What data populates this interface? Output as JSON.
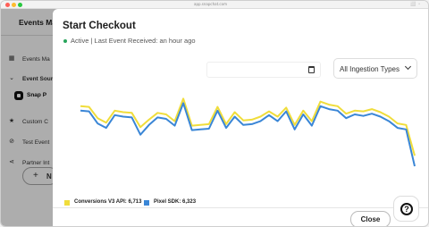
{
  "window": {
    "url": "app.snapchat.com"
  },
  "app": {
    "title": "Events Ma",
    "sidebar": {
      "items": [
        {
          "label": "Events Ma",
          "icon": "grid-icon"
        },
        {
          "label": "Event Sour",
          "icon": "chevron-down-icon"
        },
        {
          "label": "Snap P",
          "icon": "snap-pixel-icon"
        },
        {
          "label": "Custom C",
          "icon": "star-icon"
        },
        {
          "label": "Test Event",
          "icon": "check-circle-icon"
        },
        {
          "label": "Partner Int",
          "icon": "share-icon"
        }
      ],
      "new_button": {
        "plus": "+",
        "label": "N"
      }
    }
  },
  "modal": {
    "title": "Start Checkout",
    "status": "Active | Last Event Received: an hour ago",
    "status_color": "#27a55b",
    "date_range": "",
    "ingestion_select": {
      "selected": "All Ingestion Types"
    },
    "legend": [
      {
        "label": "Conversions V3 API: 6,713",
        "color": "#f0dd3b"
      },
      {
        "label": "Pixel SDK: 6,323",
        "color": "#3a86d6"
      }
    ],
    "close_label": "Close",
    "help_symbol": "?"
  },
  "chart_data": {
    "type": "line",
    "ylim": [
      0,
      100
    ],
    "grid": false,
    "legend_position": "bottom-left",
    "series": [
      {
        "name": "Conversions V3 API: 6,713",
        "color": "#f0dd3b",
        "values": [
          86,
          85,
          70,
          64,
          80,
          78,
          77,
          58,
          68,
          77,
          75,
          66,
          96,
          60,
          61,
          62,
          85,
          62,
          78,
          67,
          68,
          72,
          79,
          72,
          84,
          61,
          80,
          66,
          92,
          88,
          86,
          76,
          80,
          79,
          82,
          78,
          72,
          63,
          61,
          20
        ]
      },
      {
        "name": "Pixel SDK: 6,323",
        "color": "#3a86d6",
        "values": [
          80,
          79,
          63,
          57,
          74,
          72,
          71,
          48,
          61,
          71,
          69,
          60,
          90,
          54,
          55,
          56,
          80,
          57,
          72,
          61,
          62,
          66,
          74,
          66,
          79,
          55,
          75,
          60,
          86,
          82,
          80,
          70,
          75,
          73,
          76,
          72,
          66,
          57,
          55,
          6
        ]
      }
    ]
  }
}
